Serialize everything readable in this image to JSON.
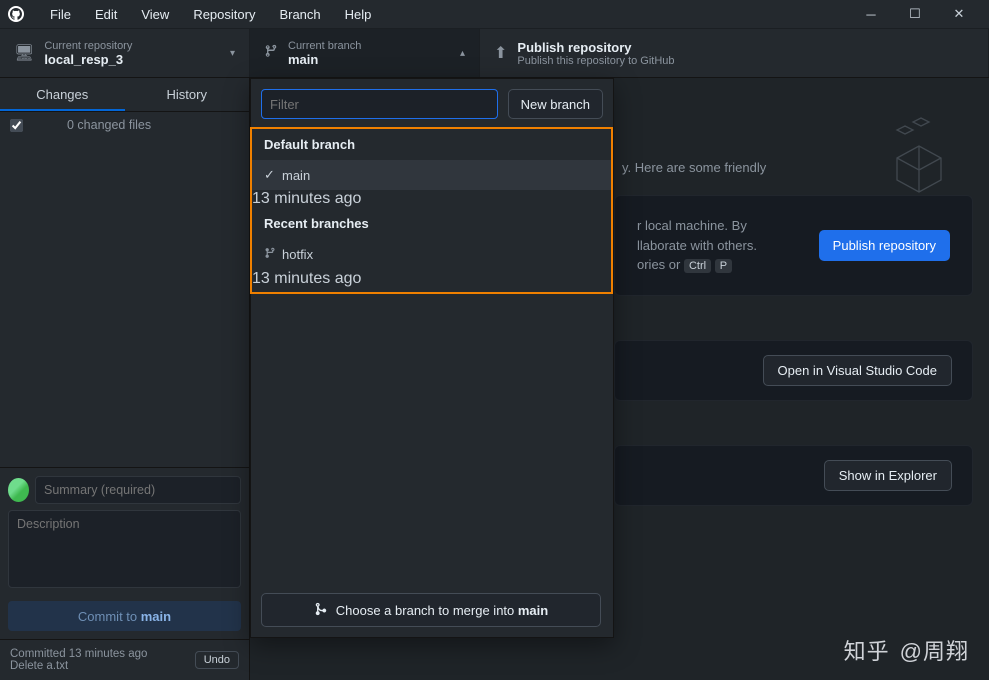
{
  "menu": {
    "file": "File",
    "edit": "Edit",
    "view": "View",
    "repository": "Repository",
    "branch": "Branch",
    "help": "Help"
  },
  "toolbar": {
    "repo_label": "Current repository",
    "repo_name": "local_resp_3",
    "branch_label": "Current branch",
    "branch_name": "main",
    "publish_title": "Publish repository",
    "publish_sub": "Publish this repository to GitHub"
  },
  "sidebar": {
    "tab_changes": "Changes",
    "tab_history": "History",
    "files_header": "0 changed files",
    "summary_placeholder": "Summary (required)",
    "description_placeholder": "Description",
    "commit_prefix": "Commit to ",
    "commit_branch": "main",
    "meta_line1": "Committed 13 minutes ago",
    "meta_line2": "Delete a.txt",
    "undo": "Undo"
  },
  "dropdown": {
    "filter_placeholder": "Filter",
    "new_branch": "New branch",
    "section_default": "Default branch",
    "section_recent": "Recent branches",
    "branches": [
      {
        "name": "main",
        "time": "13 minutes ago",
        "selected": true
      },
      {
        "name": "hotfix",
        "time": "13 minutes ago",
        "selected": false
      }
    ],
    "merge_label_pre": "Choose a branch to merge into ",
    "merge_branch": "main"
  },
  "content": {
    "hint_tail": "y. Here are some friendly",
    "card1_line1": "r local machine. By",
    "card1_line2": "llaborate with others.",
    "card1_line3_pre": "ories or ",
    "kbd_ctrl": "Ctrl",
    "kbd_p": "P",
    "publish_btn": "Publish repository",
    "vscode_btn": "Open in Visual Studio Code",
    "explorer_btn": "Show in Explorer"
  },
  "watermark": {
    "brand": "知乎",
    "at": "@周翔"
  }
}
